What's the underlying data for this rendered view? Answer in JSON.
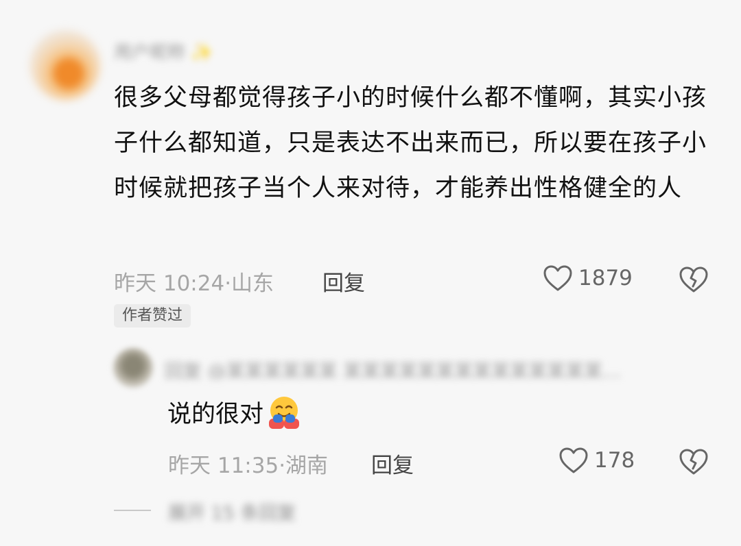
{
  "comment": {
    "username_blurred": "用户昵称 ✨",
    "text": "很多父母都觉得孩子小的时候什么都不懂啊，其实小孩子什么都知道，只是表达不出来而已，所以要在孩子小时候就把孩子当个人来对待，才能养出性格健全的人",
    "meta": "昨天 10:24·山东",
    "reply_label": "回复",
    "likes": "1879",
    "author_badge": "作者赞过"
  },
  "reply": {
    "quote_blurred": "回复 @某某某某某某 某某某某某某某某某某某某某某…",
    "text": "说的很对",
    "emoji_icon": "hugging-face-emoji",
    "meta": "昨天 11:35·湖南",
    "reply_label": "回复",
    "likes": "178"
  },
  "more_replies_blurred": "展开 15 条回复"
}
